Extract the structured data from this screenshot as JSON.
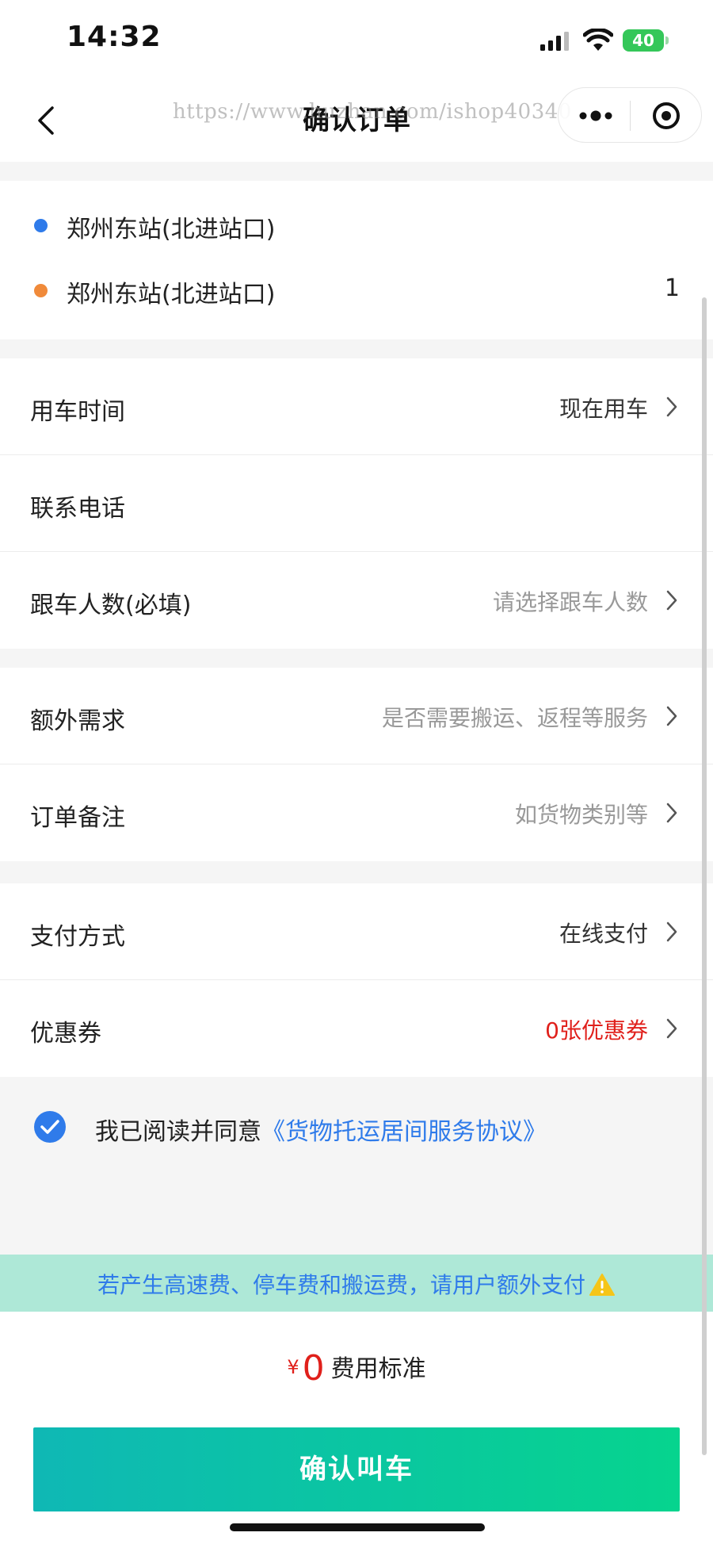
{
  "status_bar": {
    "time": "14:32",
    "battery": "40"
  },
  "nav": {
    "title": "确认订单",
    "watermark": "https://www.huzhan.com/ishop40340",
    "more_icon": "more-dots-icon",
    "close_icon": "target-circle-icon"
  },
  "route": {
    "start": {
      "name": "郑州东站(北进站口)",
      "color": "#2f7bea"
    },
    "end": {
      "name": "郑州东站(北进站口)",
      "color": "#f08a3a",
      "count": "1"
    }
  },
  "form": {
    "time": {
      "label": "用车时间",
      "value": "现在用车"
    },
    "phone": {
      "label": "联系电话",
      "value": ""
    },
    "riders": {
      "label": "跟车人数(必填)",
      "placeholder": "请选择跟车人数"
    },
    "extra": {
      "label": "额外需求",
      "placeholder": "是否需要搬运、返程等服务"
    },
    "remark": {
      "label": "订单备注",
      "placeholder": "如货物类别等"
    },
    "payment": {
      "label": "支付方式",
      "value": "在线支付"
    },
    "coupon": {
      "label": "优惠券",
      "value": "0张优惠券"
    }
  },
  "agreement": {
    "checked": true,
    "prefix": "我已阅读并同意",
    "link": "《货物托运居间服务协议》"
  },
  "notice": {
    "text": "若产生高速费、停车费和搬运费，请用户额外支付"
  },
  "price": {
    "currency": "¥",
    "amount": "0",
    "label": "费用标准"
  },
  "confirm_label": "确认叫车",
  "colors": {
    "accent_blue": "#2f7bea",
    "price_red": "#e0201b",
    "button_start": "#0fb8b5",
    "button_end": "#06d48e",
    "notice_bg": "#aee8d7"
  }
}
